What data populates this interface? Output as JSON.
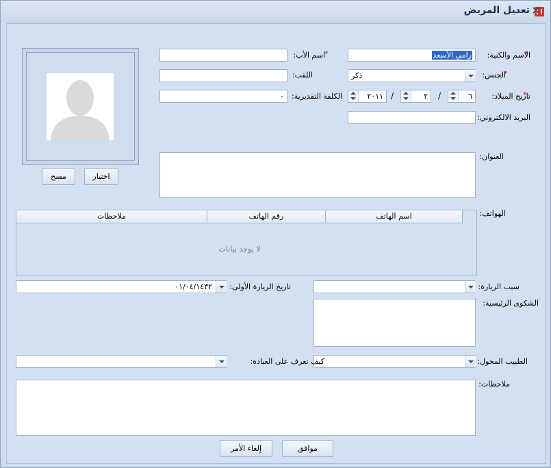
{
  "window": {
    "title": "تعديل المريض",
    "minimize": "▭",
    "close": "✕"
  },
  "fields": {
    "full_name": {
      "label": "الاسم والكنية:",
      "value": "رامي الأسعد"
    },
    "father_name": {
      "label": "اسم الأب:",
      "value": ""
    },
    "gender": {
      "label": "الجنس:",
      "value": "ذكر"
    },
    "nickname": {
      "label": "اللقب:",
      "value": ""
    },
    "birth_date": {
      "label": "تاريخ الميلاد:",
      "year": "٢٠١١",
      "month": "٢",
      "day": "٦",
      "sep": "/"
    },
    "estimated_cost": {
      "label": "الكلفة التقديرية:",
      "value": "٠"
    },
    "email": {
      "label": "البريد الالكتروني:",
      "value": ""
    },
    "address": {
      "label": "العنوان:",
      "value": ""
    },
    "phones": {
      "label": "الهواتف:",
      "columns": [
        "اسم الهاتف",
        "رقم الهاتف",
        "ملاحظات"
      ],
      "empty_text": "لا يوجد بيانات"
    },
    "visit_reason": {
      "label": "سبب الزيارة:",
      "value": ""
    },
    "first_visit_date": {
      "label": "تاريخ الزيارة الأولى:",
      "value": "٠١/٠٤/١٤٣٢"
    },
    "chief_complaint": {
      "label": "الشكوى الرئيسية:",
      "value": ""
    },
    "referring_doctor": {
      "label": "الطبيب المحول:",
      "value": ""
    },
    "how_heard": {
      "label": "كيف تعرف على العيادة:",
      "value": ""
    },
    "notes": {
      "label": "ملاحظات:",
      "value": ""
    }
  },
  "photo": {
    "choose": "اختيار",
    "clear": "مسح"
  },
  "buttons": {
    "ok": "موافق",
    "cancel": "إلغاء الأمر"
  },
  "required_mark": "*"
}
